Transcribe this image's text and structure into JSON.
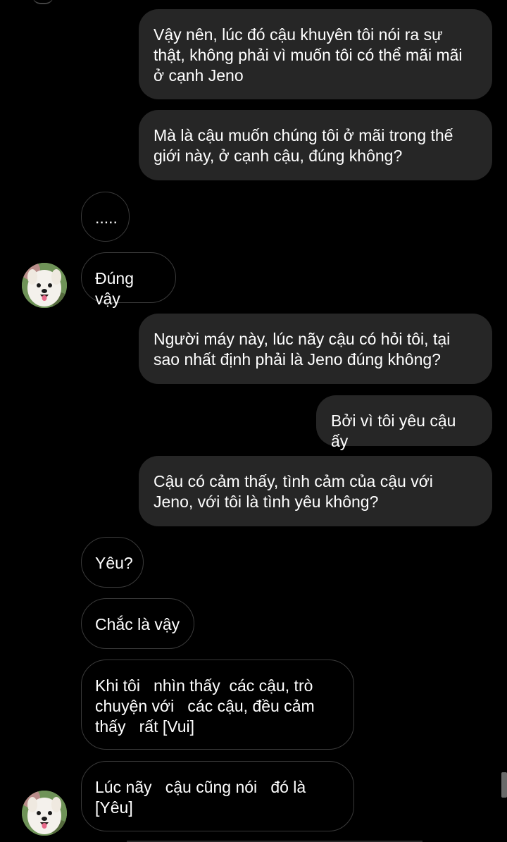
{
  "conversation": {
    "messages": [
      {
        "direction": "sent",
        "text": "Vậy nên, lúc đó cậu khuyên tôi nói ra sự thật, không phải vì muốn tôi có thể mãi mãi ở cạnh Jeno"
      },
      {
        "direction": "sent",
        "text": "Mà là cậu muốn chúng tôi ở mãi trong thế giới này, ở cạnh cậu, đúng không?"
      },
      {
        "direction": "received",
        "text": "....."
      },
      {
        "direction": "received",
        "text": "Đúng vậy"
      },
      {
        "direction": "sent",
        "text": "Người máy này, lúc nãy cậu có hỏi tôi, tại sao nhất định phải là Jeno đúng không?"
      },
      {
        "direction": "sent",
        "text": "Bởi vì tôi yêu cậu ấy"
      },
      {
        "direction": "sent",
        "text": "Cậu có cảm thấy, tình cảm của cậu với Jeno, với tôi là tình yêu không?"
      },
      {
        "direction": "received",
        "text": "Yêu?"
      },
      {
        "direction": "received",
        "text": "Chắc là vậy"
      },
      {
        "direction": "received",
        "text": "Khi tôi   nhìn thấy  các cậu, trò chuyện với   các cậu, đều cảm thấy   rất [Vui]"
      },
      {
        "direction": "received",
        "text": "Lúc nãy   cậu cũng nói   đó là [Yêu]"
      }
    ],
    "avatar_icon": "samoyed-dog-avatar-icon"
  },
  "colors": {
    "background": "#000000",
    "sent_bubble": "#262626",
    "received_border": "#3a3a3a",
    "text": "#ffffff"
  }
}
